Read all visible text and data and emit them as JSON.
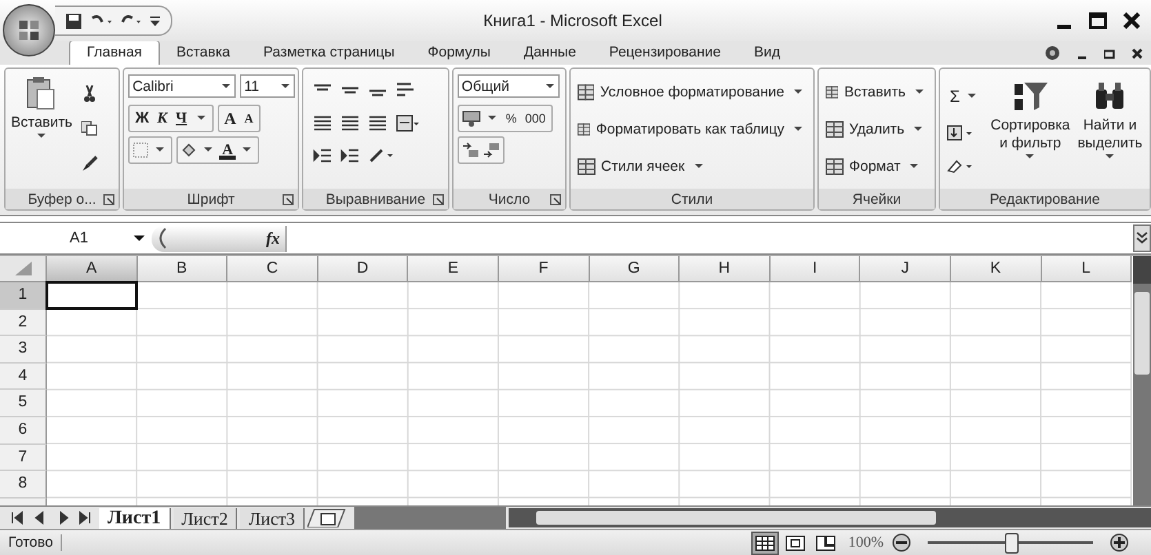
{
  "window": {
    "title": "Книга1 - Microsoft Excel"
  },
  "tabs": [
    {
      "label": "Главная",
      "selected": true
    },
    {
      "label": "Вставка",
      "selected": false
    },
    {
      "label": "Разметка страницы",
      "selected": false
    },
    {
      "label": "Формулы",
      "selected": false
    },
    {
      "label": "Данные",
      "selected": false
    },
    {
      "label": "Рецензирование",
      "selected": false
    },
    {
      "label": "Вид",
      "selected": false
    }
  ],
  "ribbon": [
    {
      "kind": "clipboard",
      "label": "Буфер о...",
      "paste": "Вставить"
    },
    {
      "kind": "font",
      "label": "Шрифт",
      "font": "Calibri",
      "size": "11",
      "bold": "Ж",
      "italic": "К",
      "underline": "Ч",
      "grow": "A",
      "shrink": "A",
      "color_letter": "A"
    },
    {
      "kind": "alignment",
      "label": "Выравнивание"
    },
    {
      "kind": "number",
      "label": "Число",
      "format": "Общий",
      "percent": "%",
      "thousands": "000"
    },
    {
      "kind": "styles",
      "label": "Стили",
      "items": [
        "Условное форматирование",
        "Форматировать как таблицу",
        "Стили ячеек"
      ]
    },
    {
      "kind": "cells",
      "label": "Ячейки",
      "items": [
        "Вставить",
        "Удалить",
        "Формат"
      ]
    },
    {
      "kind": "editing",
      "label": "Редактирование",
      "sum": "Σ",
      "sort": "Сортировка и фильтр",
      "find": "Найти и выделить"
    }
  ],
  "formula_bar": {
    "name_box": "A1",
    "fx": "fx"
  },
  "grid": {
    "columns": [
      {
        "label": "A",
        "selected": true
      },
      {
        "label": "B",
        "selected": false
      },
      {
        "label": "C",
        "selected": false
      },
      {
        "label": "D",
        "selected": false
      },
      {
        "label": "E",
        "selected": false
      },
      {
        "label": "F",
        "selected": false
      },
      {
        "label": "G",
        "selected": false
      },
      {
        "label": "H",
        "selected": false
      },
      {
        "label": "I",
        "selected": false
      },
      {
        "label": "J",
        "selected": false
      },
      {
        "label": "K",
        "selected": false
      },
      {
        "label": "L",
        "selected": false
      }
    ],
    "rows": [
      {
        "label": "1",
        "selected": true
      },
      {
        "label": "2",
        "selected": false
      },
      {
        "label": "3",
        "selected": false
      },
      {
        "label": "4",
        "selected": false
      },
      {
        "label": "5",
        "selected": false
      },
      {
        "label": "6",
        "selected": false
      },
      {
        "label": "7",
        "selected": false
      },
      {
        "label": "8",
        "selected": false
      }
    ]
  },
  "sheets": [
    {
      "label": "Лист1",
      "selected": true
    },
    {
      "label": "Лист2",
      "selected": false
    },
    {
      "label": "Лист3",
      "selected": false
    }
  ],
  "status_bar": {
    "status": "Готово",
    "zoom": "100%",
    "level": 0.5,
    "views": [
      {
        "kind": "normal",
        "selected": true
      },
      {
        "kind": "layout",
        "selected": false
      },
      {
        "kind": "page_break",
        "selected": false
      }
    ]
  }
}
